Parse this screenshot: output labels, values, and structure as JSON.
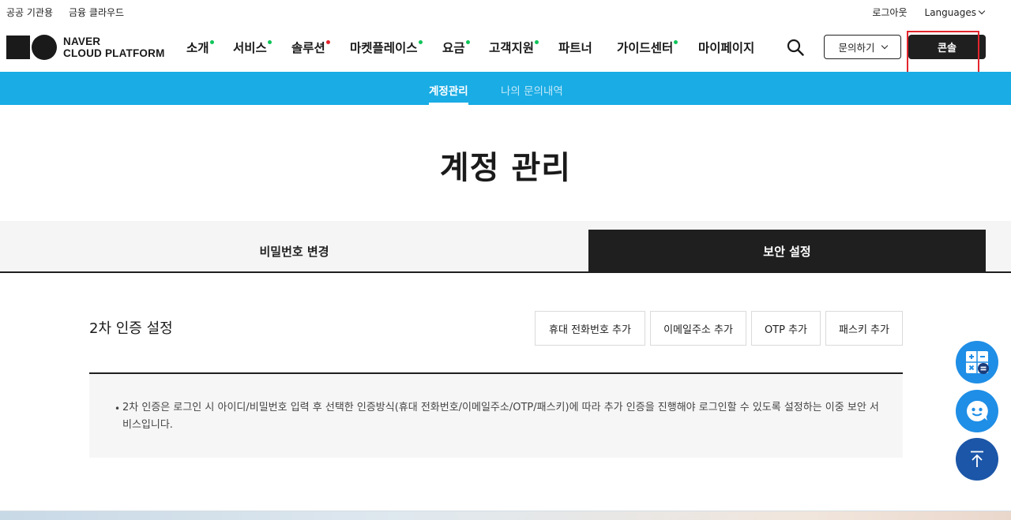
{
  "topbar": {
    "left_links": [
      "공공 기관용",
      "금융 클라우드"
    ],
    "logout": "로그아웃",
    "languages": "Languages"
  },
  "logo": {
    "line1": "NAVER",
    "line2": "CLOUD PLATFORM"
  },
  "nav": {
    "items": [
      {
        "label": "소개",
        "dot": "#10c55a"
      },
      {
        "label": "서비스",
        "dot": "#10c55a"
      },
      {
        "label": "솔루션",
        "dot": "#e3262d"
      },
      {
        "label": "마켓플레이스",
        "dot": "#10c55a"
      },
      {
        "label": "요금",
        "dot": "#10c55a"
      },
      {
        "label": "고객지원",
        "dot": "#10c55a"
      },
      {
        "label": "파트너",
        "dot": ""
      },
      {
        "label": "가이드센터",
        "dot": "#10c55a"
      },
      {
        "label": "마이페이지",
        "dot": ""
      }
    ],
    "inquiry_label": "문의하기",
    "console_label": "콘솔"
  },
  "subnav": {
    "items": [
      "계정관리",
      "나의 문의내역"
    ],
    "active": "계정관리",
    "bg": "#19ace5"
  },
  "page_title": "계정 관리",
  "tabs": {
    "left": "비밀번호 변경",
    "right": "보안 설정",
    "active": "보안 설정"
  },
  "two_factor": {
    "title": "2차 인증 설정",
    "buttons": [
      "휴대 전화번호 추가",
      "이메일주소 추가",
      "OTP 추가",
      "패스키 추가"
    ],
    "info_text": "2차 인증은 로그인 시 아이디/비밀번호 입력 후 선택한 인증방식(휴대 전화번호/이메일주소/OTP/패스키)에 따라 추가 인증을 진행해야 로그인할 수 있도록 설정하는 이중 보안 서비스입니다."
  },
  "floating_buttons": [
    "calculator-icon",
    "chatbot-icon",
    "scroll-top-icon"
  ],
  "colors": {
    "accent": "#19ace5",
    "dark": "#1f1f1f",
    "highlight": "#e3262d",
    "fab": "#1f8ee6"
  }
}
